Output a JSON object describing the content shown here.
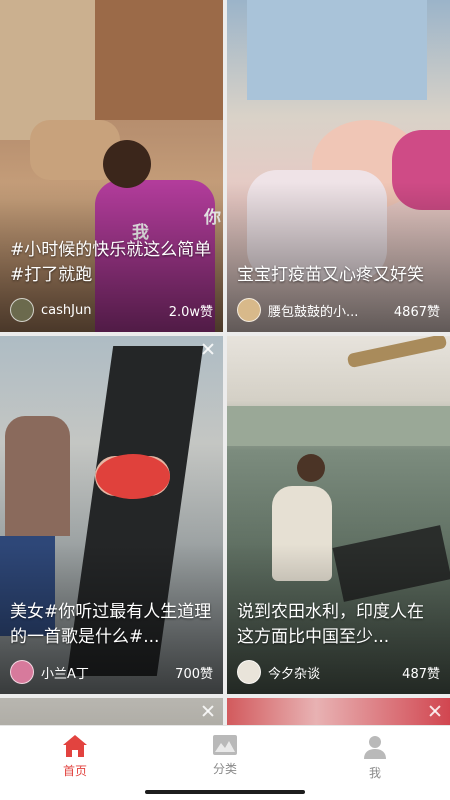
{
  "feed": [
    {
      "caption": "#小时候的快乐就这么简单#打了就跑",
      "author": "cashJun",
      "likes": "2.0w赞",
      "overlay_text": [
        "我",
        "你"
      ]
    },
    {
      "caption": "宝宝打疫苗又心疼又好笑",
      "author": "腰包鼓鼓的小...",
      "likes": "4867赞"
    },
    {
      "caption": "美女#你听过最有人生道理的一首歌是什么#...",
      "author": "小兰A丁",
      "likes": "700赞"
    },
    {
      "caption": "说到农田水利，印度人在这方面比中国至少...",
      "author": "今夕杂谈",
      "likes": "487赞"
    },
    {
      "caption": "",
      "author": "",
      "likes": ""
    },
    {
      "caption": "",
      "author": "",
      "likes": ""
    }
  ],
  "tabbar": {
    "items": [
      {
        "label": "首页",
        "icon": "home-icon",
        "active": true
      },
      {
        "label": "分类",
        "icon": "category-icon",
        "active": false
      },
      {
        "label": "我",
        "icon": "user-icon",
        "active": false
      }
    ]
  },
  "colors": {
    "accent": "#e2433f",
    "inactive": "#8a8a8a",
    "background": "#ececec"
  }
}
